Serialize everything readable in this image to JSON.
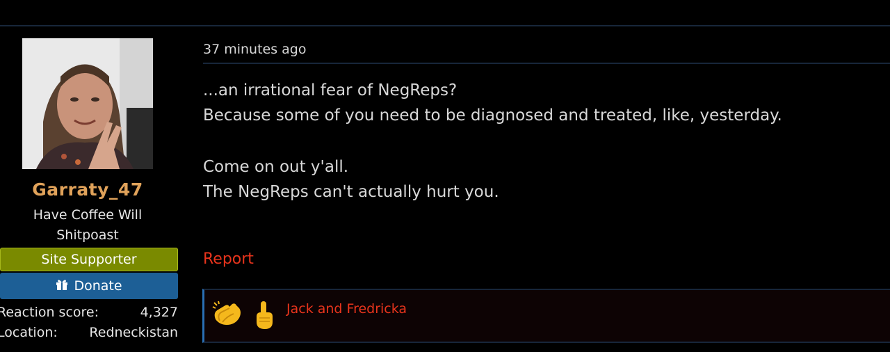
{
  "post": {
    "date": "37 minutes ago",
    "lines": [
      "...an irrational fear of NegReps?",
      "Because some of you need to be diagnosed and treated, like, yesterday.",
      "",
      "Come on out y'all.",
      "The NegReps can't actually hurt you."
    ],
    "report_label": "Report"
  },
  "user": {
    "name": "Garraty_47",
    "title_lines": [
      "Have Coffee Will",
      "Shitpoast"
    ],
    "banner": "Site Supporter",
    "donate_label": "Donate",
    "stats": [
      {
        "label": "Reaction score:",
        "value": "4,327"
      },
      {
        "label": "Location:",
        "value": "Redneckistan"
      }
    ]
  },
  "reactions": {
    "icons": [
      "clapping-hands-icon",
      "pointing-up-icon"
    ],
    "names": "Jack and Fredricka"
  },
  "colors": {
    "background": "#000000",
    "username": "#e0a25a",
    "supporter_banner": "#7a8a00",
    "donate_button": "#1d5f96",
    "link_red": "#e8341c",
    "divider": "#17263a",
    "reaction_accent": "#2a6fb4"
  }
}
